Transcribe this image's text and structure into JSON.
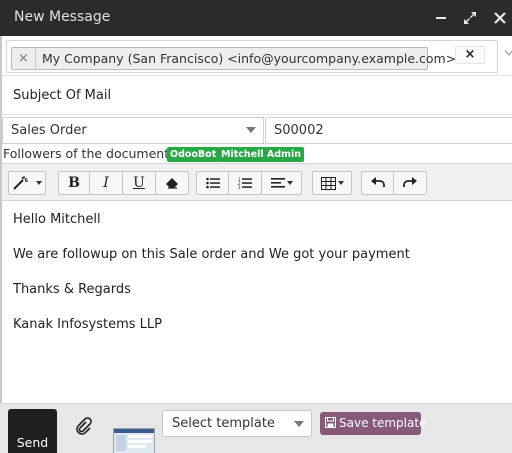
{
  "window": {
    "title": "New Message",
    "icons": [
      "minimize-icon",
      "expand-icon",
      "close-icon"
    ]
  },
  "recipients": {
    "tags": [
      {
        "remove": "×",
        "label": "My Company (San Francisco) <info@yourcompany.example.com>"
      }
    ],
    "clear": "×"
  },
  "subject": "Subject Of Mail",
  "document": {
    "model": "Sales Order",
    "reference": "S00002"
  },
  "followers": {
    "label": "Followers of the document:",
    "list": [
      "OdooBot",
      "Mitchell Admin"
    ],
    "badge_color": "#28a745"
  },
  "toolbar": {
    "buttons": [
      "magic-wand-icon",
      "bold-icon",
      "italic-icon",
      "underline-icon",
      "eraser-icon",
      "unordered-list-icon",
      "ordered-list-icon",
      "align-icon",
      "table-icon",
      "undo-icon",
      "redo-icon"
    ],
    "bold_label": "B",
    "italic_label": "I",
    "underline_label": "U"
  },
  "body": [
    "Hello Mitchell",
    "We are followup on this Sale order and We got your payment",
    "Thanks & Regards",
    "Kanak Infosystems LLP"
  ],
  "footer": {
    "send_label": "Send",
    "template_select": "Select template",
    "save_template_label": "Save template",
    "save_template_color": "#875a7b"
  }
}
